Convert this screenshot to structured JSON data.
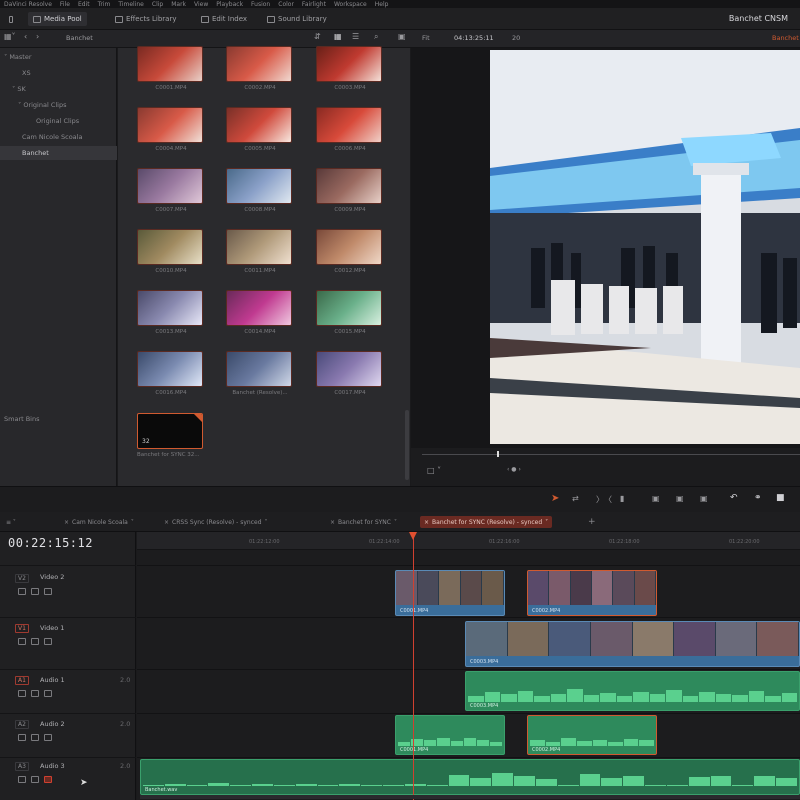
{
  "menubar": {
    "items": [
      "DaVinci Resolve",
      "File",
      "Edit",
      "Trim",
      "Timeline",
      "Clip",
      "Mark",
      "View",
      "Playback",
      "Fusion",
      "Color",
      "Fairlight",
      "Workspace",
      "Help"
    ]
  },
  "toolbar": {
    "media_pool": "Media Pool",
    "effects_library": "Effects Library",
    "edit_index": "Edit Index",
    "sound_library": "Sound Library",
    "project_title": "Banchet CNSM"
  },
  "subbar": {
    "bin_name": "Banchet",
    "fit": "Fit",
    "viewer_timecode": "04:13:25:11",
    "viewer_frames": "20",
    "timeline_name": "Banchet"
  },
  "bins": {
    "items": [
      "Master",
      "XS",
      "SK",
      "Original Clips",
      "Original Clips",
      "Cam Nicole Scoala",
      "Banchet"
    ],
    "selected": "Banchet",
    "smart_bins": "Smart Bins"
  },
  "clips": [
    {
      "name": "C0001.MP4"
    },
    {
      "name": "C0002.MP4"
    },
    {
      "name": "C0003.MP4"
    },
    {
      "name": "C0004.MP4"
    },
    {
      "name": "C0005.MP4"
    },
    {
      "name": "C0006.MP4"
    },
    {
      "name": "C0007.MP4"
    },
    {
      "name": "C0008.MP4"
    },
    {
      "name": "C0009.MP4"
    },
    {
      "name": "C0010.MP4"
    },
    {
      "name": "C0011.MP4"
    },
    {
      "name": "C0012.MP4"
    },
    {
      "name": "C0013.MP4"
    },
    {
      "name": "C0014.MP4"
    },
    {
      "name": "C0015.MP4"
    },
    {
      "name": "C0016.MP4"
    },
    {
      "name": "Banchet (Resolve)..."
    },
    {
      "name": "C0017.MP4"
    }
  ],
  "timeline_clip": {
    "name": "Banchet for SYNC 32...",
    "count": "32"
  },
  "tabs": [
    {
      "label": "Cam Nicole Scoala"
    },
    {
      "label": "CRSS Sync (Resolve) - synced"
    },
    {
      "label": "Banchet for SYNC"
    },
    {
      "label": "Banchet for SYNC (Resolve) - synced"
    }
  ],
  "timeline": {
    "timecode": "00:22:15:12",
    "ruler": [
      "01:22:12:00",
      "01:22:14:00",
      "01:22:16:00",
      "01:22:18:00",
      "01:22:20:00"
    ]
  },
  "tracks": [
    {
      "id": "V2",
      "name": "Video 2"
    },
    {
      "id": "V1",
      "name": "Video 1"
    },
    {
      "id": "A1",
      "name": "Audio 1",
      "ch": "2.0"
    },
    {
      "id": "A2",
      "name": "Audio 2",
      "ch": "2.0"
    },
    {
      "id": "A3",
      "name": "Audio 3",
      "ch": "2.0"
    }
  ],
  "timeline_clips": {
    "v2a": "C0001.MP4",
    "v2b": "C0002.MP4",
    "v1": "C0003.MP4",
    "a1": "C0003.MP4",
    "a2a": "C0001.MP4",
    "a2b": "C0002.MP4",
    "a3": "Banchet.wav"
  },
  "colors": {
    "accent": "#d05a30",
    "video": "#3a6d9a",
    "audio": "#2e8a5c"
  }
}
